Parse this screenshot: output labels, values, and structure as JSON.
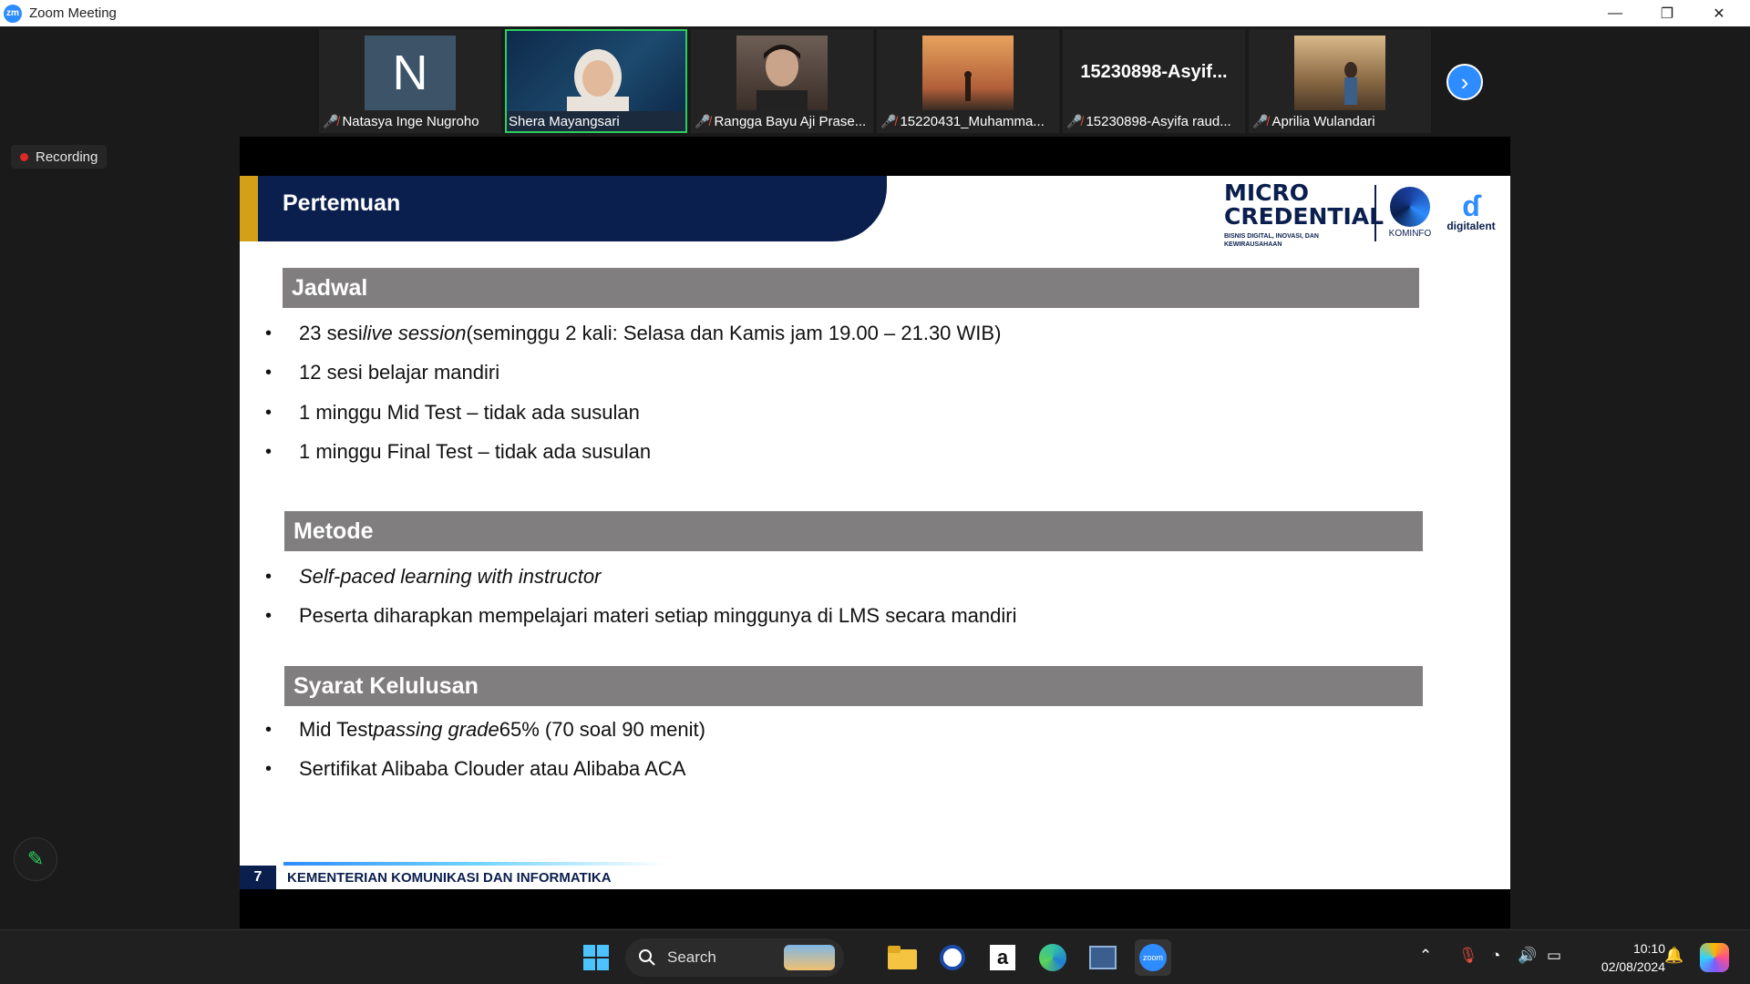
{
  "window": {
    "title": "Zoom Meeting",
    "logo_text": "zm"
  },
  "gallery": {
    "participants": [
      {
        "name": "Natasya Inge Nugroho",
        "avatar_letter": "N",
        "muted": true
      },
      {
        "name": "Shera Mayangsari",
        "muted": false,
        "active": true
      },
      {
        "name": "Rangga Bayu Aji Prase...",
        "muted": true
      },
      {
        "name": "15220431_Muhamma...",
        "muted": true
      },
      {
        "name": "15230898-Asyifa raud...",
        "tile_title": "15230898-Asyif...",
        "muted": true
      },
      {
        "name": "Aprilia Wulandari",
        "muted": true
      }
    ]
  },
  "recording_label": "Recording",
  "slide": {
    "title": "Pertemuan",
    "logo": {
      "line1": "MICRO",
      "line2": "CREDENTIAL",
      "tagline": "BISNIS DIGITAL, INOVASI, DAN KEWIRAUSAHAAN",
      "kominfo": "KOMINFO",
      "digitalent": "digitalent"
    },
    "sections": {
      "jadwal": {
        "heading": "Jadwal",
        "b1_pre": "23 sesi ",
        "b1_em": "live session",
        "b1_post": " (seminggu 2 kali: Selasa dan Kamis jam 19.00 – 21.30 WIB)",
        "b2": "12 sesi belajar mandiri",
        "b3": "1 minggu Mid Test  – tidak ada susulan",
        "b4": "1 minggu Final Test – tidak ada susulan"
      },
      "metode": {
        "heading": "Metode",
        "b1_em": "Self-paced learning with instructor",
        "b2": "Peserta diharapkan mempelajari materi setiap minggunya di LMS secara mandiri"
      },
      "syarat": {
        "heading": "Syarat Kelulusan",
        "b1_pre": "Mid Test ",
        "b1_em": "passing grade",
        "b1_post": " 65% (70 soal 90 menit)",
        "b2": "Sertifikat Alibaba Clouder atau Alibaba ACA"
      }
    },
    "bullet_char": "•",
    "page_number": "7",
    "footer": "KEMENTERIAN KOMUNIKASI DAN INFORMATIKA"
  },
  "taskbar": {
    "search_label": "Search",
    "time": "10:10",
    "date": "02/08/2024"
  },
  "colors": {
    "navy": "#0b1f4e",
    "gold": "#d4a017",
    "section_gray": "#807e7f",
    "zoom_blue": "#2d8cff"
  }
}
